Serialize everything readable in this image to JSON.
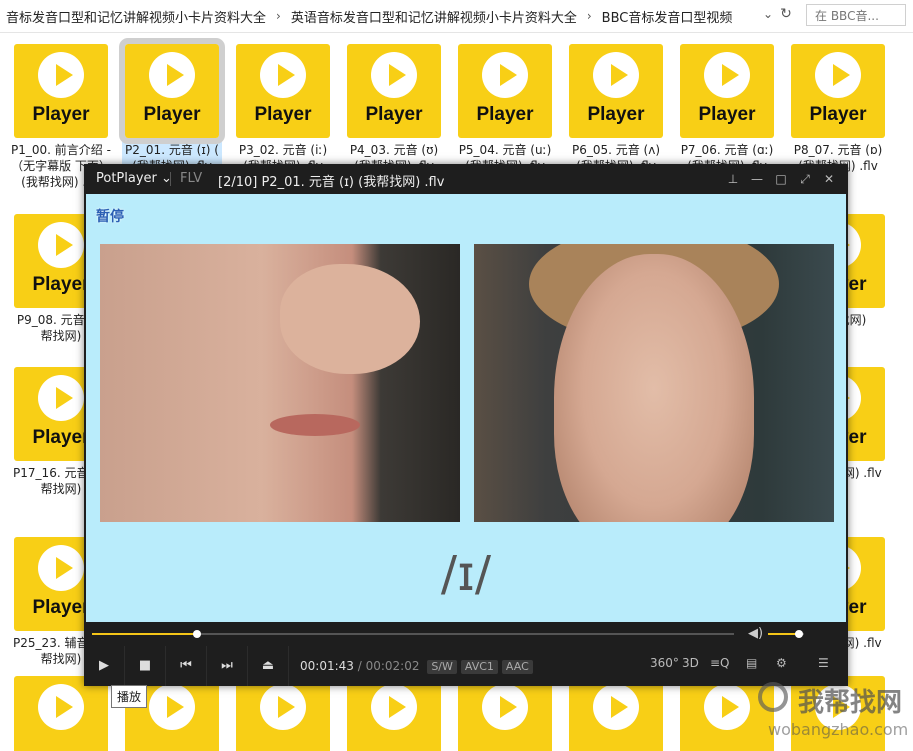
{
  "address_bar": {
    "crumbs": [
      "音标发音口型和记忆讲解视频小卡片资料大全",
      "英语音标发音口型和记忆讲解视频小卡片资料大全",
      "BBC音标发音口型视频"
    ],
    "separator": "›",
    "search_placeholder": "在 BBC音..."
  },
  "file_tiles": {
    "thumb_label": "Player",
    "rows": [
      {
        "items": [
          {
            "name": "P1_00. 前言介绍 - （无字幕版 下面） (我帮找网) .flv"
          },
          {
            "name": "P2_01. 元音 (ɪ) ( (我帮找网) .flv",
            "selected": true
          },
          {
            "name": "P3_02. 元音 (iː) (我帮找网) .flv"
          },
          {
            "name": "P4_03. 元音 (ʊ) (我帮找网) .flv"
          },
          {
            "name": "P5_04. 元音 (uː) (我帮找网) .flv"
          },
          {
            "name": "P6_05. 元音 (ʌ) (我帮找网) .flv"
          },
          {
            "name": "P7_06. 元音 (ɑː) (我帮找网) .flv"
          },
          {
            "name": "P8_07. 元音 (ɒ) (我帮找网) .flv"
          }
        ]
      },
      {
        "items": [
          {
            "name": "P9_08. 元音 (我帮找网)"
          },
          {
            "name": "元音 找网)"
          }
        ]
      },
      {
        "items": [
          {
            "name": "P17_16. 元音 (我帮找网)"
          },
          {
            "name": "辅音 (b) 网) .flv"
          }
        ]
      },
      {
        "items": [
          {
            "name": "P25_23. 辅音 (我帮找网)"
          },
          {
            "name": "辅音 (ð) 网) .flv"
          }
        ]
      }
    ]
  },
  "player": {
    "logo": "PotPlayer ⌄",
    "format": "FLV",
    "file_title": "[2/10] P2_01. 元音 (ɪ) (我帮找网) .flv",
    "pause_label": "暂停",
    "ipa": "/ɪ/",
    "progress_fraction": 0.163,
    "volume_fraction": 0.85,
    "time_current": "00:01:43",
    "time_sep": " / ",
    "time_total": "00:02:02",
    "tags": [
      "S/W",
      "AVC1",
      "AAC"
    ],
    "right_icons": [
      "360°",
      "3D",
      "≡Q",
      "▤",
      "⚙",
      "☰"
    ],
    "tooltip": "播放"
  },
  "watermark": {
    "cn": "我帮找网",
    "url": "wobangzhao.com"
  },
  "colors": {
    "thumb": "#f8cf16",
    "accent": "#f5c518",
    "video_bg": "#b9ecfb"
  }
}
